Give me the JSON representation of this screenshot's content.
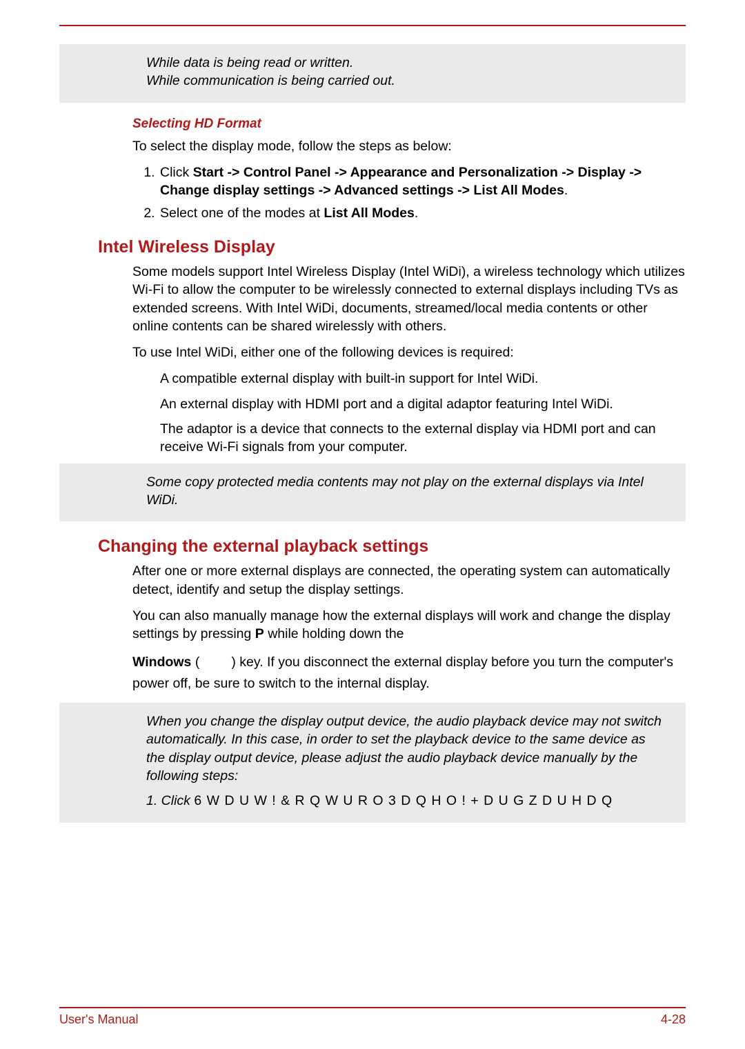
{
  "noteTop": {
    "line1": "While data is being read or written.",
    "line2": "While communication is being carried out."
  },
  "selectingHD": {
    "heading": "Selecting HD Format",
    "intro": "To select the display mode, follow the steps as below:",
    "step1_pre": "Click ",
    "step1_bold": "Start -> Control Panel -> Appearance and Personalization -> Display -> Change display settings -> Advanced settings -> List All Modes",
    "step1_post": ".",
    "step2_pre": "Select one of the modes at ",
    "step2_bold": "List All Modes",
    "step2_post": "."
  },
  "widi": {
    "heading": "Intel Wireless Display",
    "p1": "Some models support Intel Wireless Display (Intel WiDi), a wireless technology which utilizes Wi-Fi to allow the computer to be wirelessly connected to external displays including TVs as extended screens. With Intel WiDi, documents, streamed/local media contents or other online contents can be shared wirelessly with others.",
    "p2": "To use Intel WiDi, either one of the following devices is required:",
    "b1": "A compatible external display with built-in support for Intel WiDi.",
    "b2": "An external display with HDMI port and a digital adaptor featuring Intel WiDi.",
    "b3": "The adaptor is a device that connects to the external display via HDMI port and can receive Wi-Fi signals from your computer.",
    "note": "Some copy protected media contents may not play on the external displays via Intel WiDi."
  },
  "playback": {
    "heading": "Changing the external playback settings",
    "p1": "After one or more external displays are connected, the operating system can automatically detect, identify and setup the display settings.",
    "p2_a": "You can also manually manage how the external displays will work and change the display settings by pressing ",
    "p2_bold": "P",
    "p2_b": " while holding down the ",
    "p3_bold": "Windows",
    "p3_a": " (",
    "p3_b": ") key. If you disconnect the external display before you turn the computer's power off, be sure to switch to the internal display.",
    "note_p": "When you change the display output device, the audio playback device may not switch automatically. In this case, in order to set the playback device to the same device as the display output device, please adjust the audio playback device manually by the following steps:",
    "note_step_pre": "1. Click ",
    "note_step_garbled": "6 W D U W      !   & R Q W U R O   3 D Q H O      !   + D U G Z D U H   D Q"
  },
  "footer": {
    "left": "User's Manual",
    "right": "4-28"
  }
}
